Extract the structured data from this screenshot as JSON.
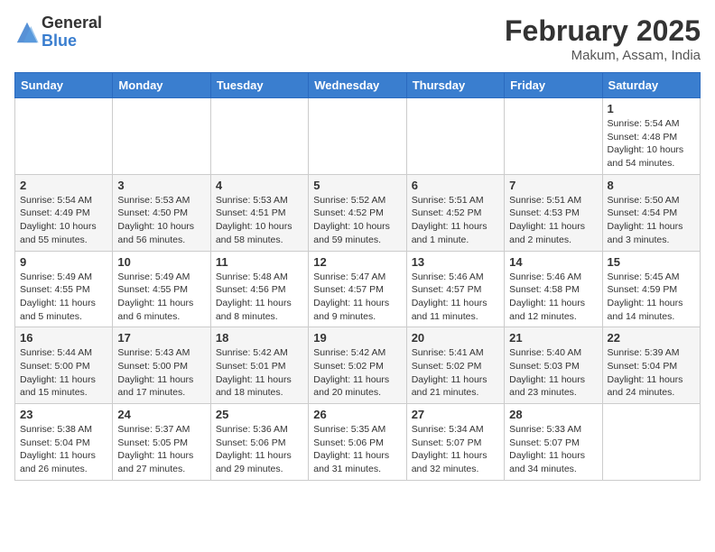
{
  "logo": {
    "general": "General",
    "blue": "Blue"
  },
  "header": {
    "month": "February 2025",
    "location": "Makum, Assam, India"
  },
  "weekdays": [
    "Sunday",
    "Monday",
    "Tuesday",
    "Wednesday",
    "Thursday",
    "Friday",
    "Saturday"
  ],
  "weeks": [
    [
      {
        "day": "",
        "info": ""
      },
      {
        "day": "",
        "info": ""
      },
      {
        "day": "",
        "info": ""
      },
      {
        "day": "",
        "info": ""
      },
      {
        "day": "",
        "info": ""
      },
      {
        "day": "",
        "info": ""
      },
      {
        "day": "1",
        "info": "Sunrise: 5:54 AM\nSunset: 4:48 PM\nDaylight: 10 hours and 54 minutes."
      }
    ],
    [
      {
        "day": "2",
        "info": "Sunrise: 5:54 AM\nSunset: 4:49 PM\nDaylight: 10 hours and 55 minutes."
      },
      {
        "day": "3",
        "info": "Sunrise: 5:53 AM\nSunset: 4:50 PM\nDaylight: 10 hours and 56 minutes."
      },
      {
        "day": "4",
        "info": "Sunrise: 5:53 AM\nSunset: 4:51 PM\nDaylight: 10 hours and 58 minutes."
      },
      {
        "day": "5",
        "info": "Sunrise: 5:52 AM\nSunset: 4:52 PM\nDaylight: 10 hours and 59 minutes."
      },
      {
        "day": "6",
        "info": "Sunrise: 5:51 AM\nSunset: 4:52 PM\nDaylight: 11 hours and 1 minute."
      },
      {
        "day": "7",
        "info": "Sunrise: 5:51 AM\nSunset: 4:53 PM\nDaylight: 11 hours and 2 minutes."
      },
      {
        "day": "8",
        "info": "Sunrise: 5:50 AM\nSunset: 4:54 PM\nDaylight: 11 hours and 3 minutes."
      }
    ],
    [
      {
        "day": "9",
        "info": "Sunrise: 5:49 AM\nSunset: 4:55 PM\nDaylight: 11 hours and 5 minutes."
      },
      {
        "day": "10",
        "info": "Sunrise: 5:49 AM\nSunset: 4:55 PM\nDaylight: 11 hours and 6 minutes."
      },
      {
        "day": "11",
        "info": "Sunrise: 5:48 AM\nSunset: 4:56 PM\nDaylight: 11 hours and 8 minutes."
      },
      {
        "day": "12",
        "info": "Sunrise: 5:47 AM\nSunset: 4:57 PM\nDaylight: 11 hours and 9 minutes."
      },
      {
        "day": "13",
        "info": "Sunrise: 5:46 AM\nSunset: 4:57 PM\nDaylight: 11 hours and 11 minutes."
      },
      {
        "day": "14",
        "info": "Sunrise: 5:46 AM\nSunset: 4:58 PM\nDaylight: 11 hours and 12 minutes."
      },
      {
        "day": "15",
        "info": "Sunrise: 5:45 AM\nSunset: 4:59 PM\nDaylight: 11 hours and 14 minutes."
      }
    ],
    [
      {
        "day": "16",
        "info": "Sunrise: 5:44 AM\nSunset: 5:00 PM\nDaylight: 11 hours and 15 minutes."
      },
      {
        "day": "17",
        "info": "Sunrise: 5:43 AM\nSunset: 5:00 PM\nDaylight: 11 hours and 17 minutes."
      },
      {
        "day": "18",
        "info": "Sunrise: 5:42 AM\nSunset: 5:01 PM\nDaylight: 11 hours and 18 minutes."
      },
      {
        "day": "19",
        "info": "Sunrise: 5:42 AM\nSunset: 5:02 PM\nDaylight: 11 hours and 20 minutes."
      },
      {
        "day": "20",
        "info": "Sunrise: 5:41 AM\nSunset: 5:02 PM\nDaylight: 11 hours and 21 minutes."
      },
      {
        "day": "21",
        "info": "Sunrise: 5:40 AM\nSunset: 5:03 PM\nDaylight: 11 hours and 23 minutes."
      },
      {
        "day": "22",
        "info": "Sunrise: 5:39 AM\nSunset: 5:04 PM\nDaylight: 11 hours and 24 minutes."
      }
    ],
    [
      {
        "day": "23",
        "info": "Sunrise: 5:38 AM\nSunset: 5:04 PM\nDaylight: 11 hours and 26 minutes."
      },
      {
        "day": "24",
        "info": "Sunrise: 5:37 AM\nSunset: 5:05 PM\nDaylight: 11 hours and 27 minutes."
      },
      {
        "day": "25",
        "info": "Sunrise: 5:36 AM\nSunset: 5:06 PM\nDaylight: 11 hours and 29 minutes."
      },
      {
        "day": "26",
        "info": "Sunrise: 5:35 AM\nSunset: 5:06 PM\nDaylight: 11 hours and 31 minutes."
      },
      {
        "day": "27",
        "info": "Sunrise: 5:34 AM\nSunset: 5:07 PM\nDaylight: 11 hours and 32 minutes."
      },
      {
        "day": "28",
        "info": "Sunrise: 5:33 AM\nSunset: 5:07 PM\nDaylight: 11 hours and 34 minutes."
      },
      {
        "day": "",
        "info": ""
      }
    ]
  ]
}
